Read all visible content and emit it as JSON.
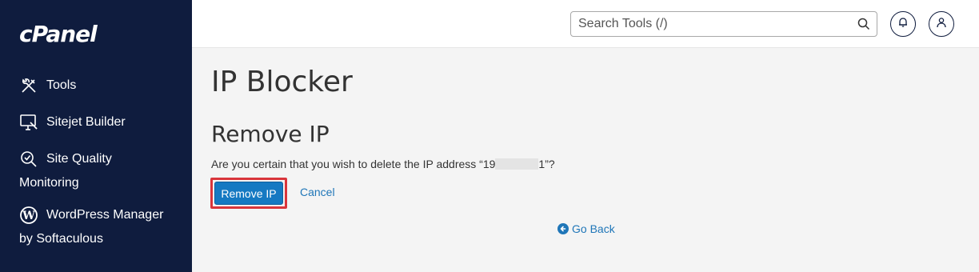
{
  "sidebar": {
    "logo": "cPanel",
    "items": [
      {
        "label": "Tools",
        "icon": "tools-icon"
      },
      {
        "label": "Sitejet Builder",
        "icon": "monitor-brush-icon"
      },
      {
        "label_line1": "Site Quality",
        "label_line2": "Monitoring",
        "icon": "magnifier-check-icon"
      },
      {
        "label_line1": "WordPress Manager",
        "label_line2": "by Softaculous",
        "icon": "wordpress-icon"
      }
    ]
  },
  "topbar": {
    "search_placeholder": "Search Tools (/)",
    "notifications_icon": "bell-icon",
    "user_icon": "user-icon"
  },
  "main": {
    "page_title": "IP Blocker",
    "section_title": "Remove IP",
    "confirm_prefix": "Are you certain that you wish to delete the IP address “19",
    "confirm_suffix": "1”?",
    "remove_button": "Remove IP",
    "cancel_link": "Cancel",
    "go_back_link": "Go Back"
  },
  "colors": {
    "sidebar_bg": "#0f1c3e",
    "primary": "#1579c2",
    "link": "#1f76b8",
    "highlight": "#d9353b"
  }
}
